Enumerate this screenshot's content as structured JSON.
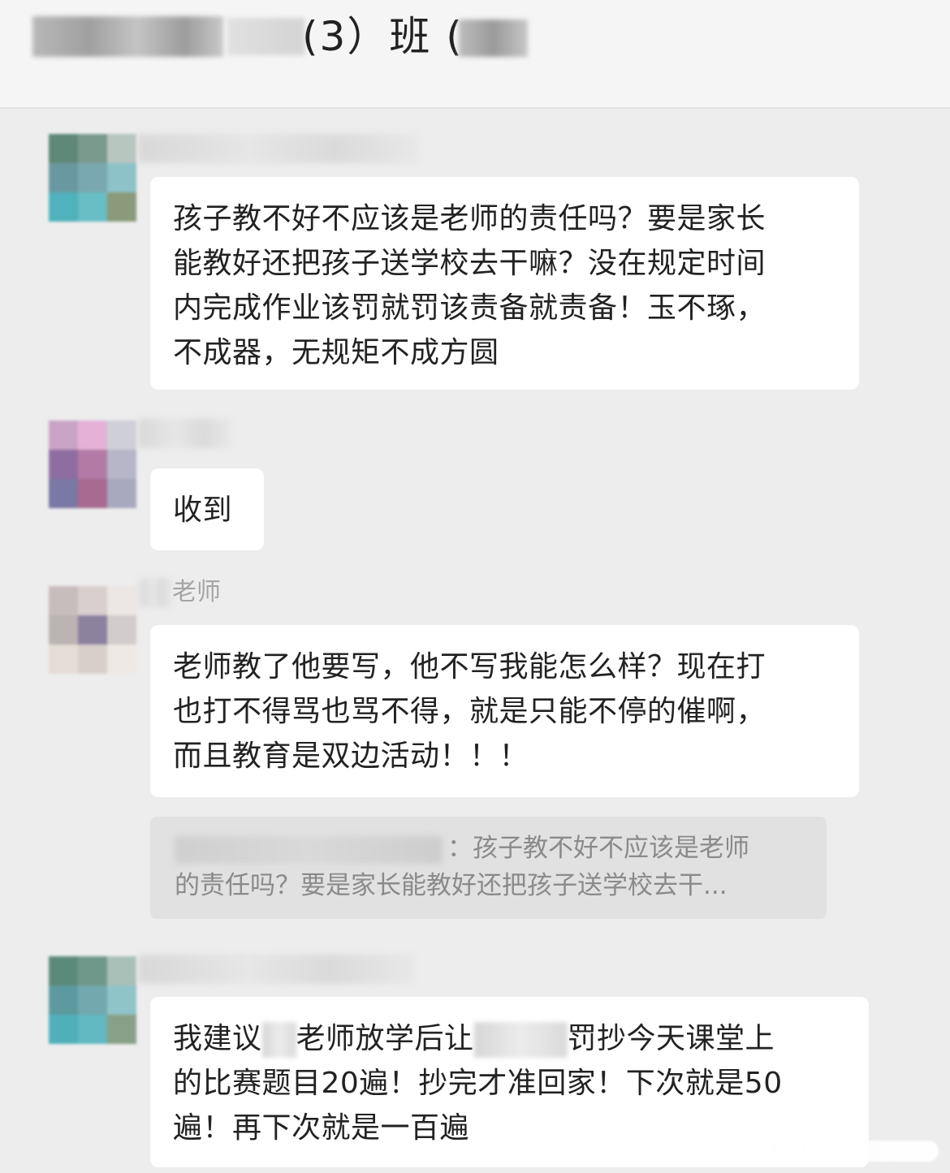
{
  "header": {
    "title": "(3）班 ("
  },
  "messages": [
    {
      "lines": [
        "孩子教不好不应该是老师的责任吗？要是家长",
        "能教好还把孩子送学校去干嘛？没在规定时间",
        "内完成作业该罚就罚该责备就责备！玉不琢，",
        "不成器，无规矩不成方圆"
      ]
    },
    {
      "lines": [
        "收到"
      ]
    },
    {
      "sender": "老师",
      "lines": [
        "老师教了他要写，他不写我能怎么样？现在打",
        "也打不得骂也骂不得，就是只能不停的催啊，",
        "而且教育是双边活动！！！"
      ],
      "quote": {
        "line1": "：孩子教不好不应该是老师",
        "line2": "的责任吗？要是家长能教好还把孩子送学校去干..."
      }
    },
    {
      "line1_part1": "我建议",
      "line1_part2": "老师放学后让",
      "line1_part3": "罚抄今天课堂上",
      "line2": "的比赛题目20遍！抄完才准回家！下次就是50",
      "line3": "遍！再下次就是一百遍"
    }
  ]
}
